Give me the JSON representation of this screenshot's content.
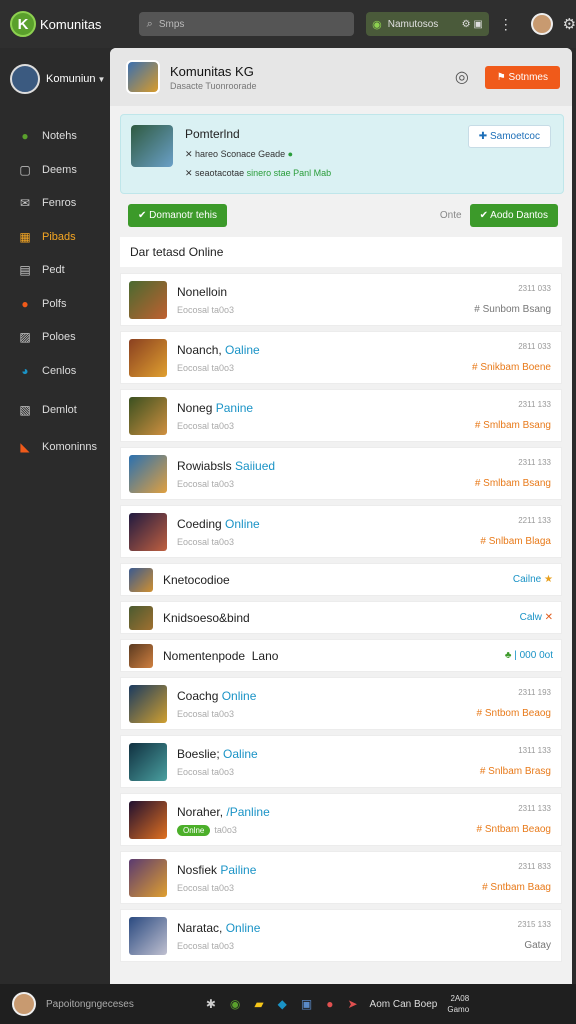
{
  "app": {
    "name": "Komunitas"
  },
  "search": {
    "placeholder": "Smps"
  },
  "notifications": {
    "label": "Namutosos"
  },
  "sidebar": {
    "user": "Komuniun",
    "items": [
      {
        "label": "Notehs",
        "icon": "circle-icon",
        "color": "#5aa02c"
      },
      {
        "label": "Deems",
        "icon": "square-icon",
        "color": "#cccccc"
      },
      {
        "label": "Fenros",
        "icon": "chat-icon",
        "color": "#cccccc"
      },
      {
        "label": "Pibads",
        "icon": "grid-icon",
        "color": "#f5a623"
      },
      {
        "label": "Pedt",
        "icon": "document-icon",
        "color": "#cccccc"
      },
      {
        "label": "Polfs",
        "icon": "pin-icon",
        "color": "#f05a1a"
      },
      {
        "label": "Poloes",
        "icon": "image-icon",
        "color": "#cccccc"
      },
      {
        "label": "Cenlos",
        "icon": "globe-icon",
        "color": "#1a93c6"
      },
      {
        "label": "Demlot",
        "icon": "chart-icon",
        "color": "#cccccc"
      },
      {
        "label": "Komoninns",
        "icon": "tag-icon",
        "color": "#f05a1a"
      }
    ]
  },
  "header": {
    "title": "Komunitas KG",
    "subtitle": "Dasacte    Tuonroorade",
    "action": "Sotnmes"
  },
  "banner": {
    "title": "Pomterlnd",
    "line1": "hareo Sconace Geade",
    "line2_prefix": "seaotacotae",
    "line2_highlight": "sinero stae Panl",
    "line2_suffix": "Mab",
    "button": "Samoetcoc"
  },
  "actions": {
    "left_button": "Domanotr tehis",
    "right_label": "Onte",
    "right_button": "Aodo Dantos"
  },
  "section": {
    "title": "Dar tetasd Online"
  },
  "members": [
    {
      "kind": "tall",
      "name": "Nonelloin",
      "status": "",
      "sub": "Eocosal ta0o3",
      "time": "2311 033",
      "tag": "# Sunbom Bsang",
      "tag_color": "gray",
      "grad": "linear-gradient(135deg,#4a6a30,#c06030)"
    },
    {
      "kind": "tall",
      "name": "Noanch,",
      "status": "Oaline",
      "sub": "Eocosal ta0o3",
      "time": "2811 033",
      "tag": "# Snikbam Boene",
      "tag_color": "orange",
      "grad": "linear-gradient(135deg,#8a4020,#e0a030)"
    },
    {
      "kind": "tall",
      "name": "Noneg",
      "status": "Panine",
      "sub": "Eocosal ta0o3",
      "time": "2311 133",
      "tag": "# Smlbam Bsang",
      "tag_color": "orange",
      "grad": "linear-gradient(135deg,#3a5020,#d09040)"
    },
    {
      "kind": "tall",
      "name": "Rowiabsls",
      "status": "Saiiued",
      "sub": "Eocosal ta0o3",
      "time": "2311 133",
      "tag": "# Smlbam Bsang",
      "tag_color": "orange",
      "grad": "linear-gradient(135deg,#2a70b0,#e0a040)"
    },
    {
      "kind": "tall",
      "name": "Coeding",
      "status": "Online",
      "sub": "Eocosal ta0o3",
      "time": "2211 133",
      "tag": "# Snlbam Blaga",
      "tag_color": "orange",
      "grad": "linear-gradient(135deg,#201a40,#c06040)"
    },
    {
      "kind": "short",
      "name": "Knetocodioe",
      "right": "Cailne",
      "right_icon": "star-icon",
      "right_glyph": "★",
      "right_class": "s",
      "grad": "linear-gradient(135deg,#3a5a90,#d09030)"
    },
    {
      "kind": "short",
      "name": "Knidsoeso&bind",
      "right": "Calw",
      "right_icon": "close-icon",
      "right_glyph": "✕",
      "right_class": "x",
      "grad": "linear-gradient(135deg,#4a5a30,#a07030)"
    },
    {
      "kind": "short",
      "name": "Nomentenpode",
      "extra": "Lano",
      "right": "000 0ot",
      "right_icon": "gift-icon",
      "right_glyph": "♣",
      "right_class": "gr",
      "grad": "linear-gradient(135deg,#5a3a20,#d08040)"
    },
    {
      "kind": "tall",
      "name": "Coachg",
      "status": "Online",
      "sub": "Eocosal ta0o3",
      "time": "2311 193",
      "tag": "# Sntbom Beaog",
      "tag_color": "orange",
      "grad": "linear-gradient(135deg,#1a3a60,#d0a030)"
    },
    {
      "kind": "tall",
      "name": "Boeslie;",
      "status": "Oaline",
      "sub": "Eocosal ta0o3",
      "time": "1311 133",
      "tag": "# Snlbam Brasg",
      "tag_color": "orange",
      "grad": "linear-gradient(135deg,#103040,#4aa0a0)"
    },
    {
      "kind": "tall",
      "name": "Noraher,",
      "status": "/Panline",
      "sub": "ta0o3",
      "pill": "Onlne",
      "time": "2311 133",
      "tag": "# Sntbam Beaog",
      "tag_color": "orange",
      "grad": "linear-gradient(135deg,#201030,#e07020)"
    },
    {
      "kind": "tall",
      "name": "Nosfiek",
      "status": "Pailine",
      "sub": "Eocosal ta0o3",
      "time": "2311 833",
      "tag": "# Sntbam Baag",
      "tag_color": "orange",
      "grad": "linear-gradient(135deg,#5a3a70,#e0a030)"
    },
    {
      "kind": "tall",
      "name": "Naratac,",
      "status": "Online",
      "sub": "Eocosal ta0o3",
      "time": "2315 133",
      "tag": "Gatay",
      "tag_color": "gray",
      "grad": "linear-gradient(135deg,#2a4a80,#c0c0d0)"
    }
  ],
  "taskbar": {
    "label": "Papoitongngeceses",
    "text": "Aom Can Boep",
    "clock_line1": "2A08",
    "clock_line2": "Gamo"
  },
  "colors": {
    "accent_orange": "#f05a1a",
    "accent_green": "#3c9a2a",
    "status_blue": "#1a93c6"
  }
}
